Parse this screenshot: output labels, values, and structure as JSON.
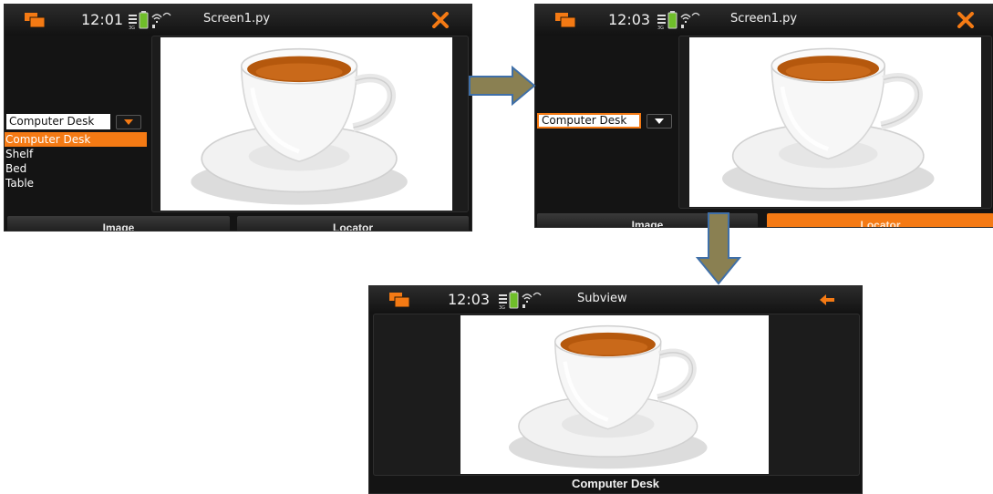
{
  "colors": {
    "accent": "#f47a14",
    "arrow_fill": "#8a8052",
    "arrow_stroke": "#3f6fa8"
  },
  "screen1": {
    "time": "12:01",
    "title": "Screen1.py",
    "action_icon": "close-icon",
    "combo_value": "Computer Desk",
    "list_items": [
      "Computer Desk",
      "Shelf",
      "Bed",
      "Table"
    ],
    "selected_item": "Computer Desk",
    "tabs": [
      "Image",
      "Locator"
    ],
    "active_tab": "none"
  },
  "screen2": {
    "time": "12:03",
    "title": "Screen1.py",
    "action_icon": "close-icon",
    "combo_value": "Computer Desk",
    "tabs": [
      "Image",
      "Locator"
    ],
    "active_tab": "Locator"
  },
  "screen3": {
    "time": "12:03",
    "title": "Subview",
    "action_icon": "back-arrow-icon",
    "caption": "Computer Desk"
  }
}
